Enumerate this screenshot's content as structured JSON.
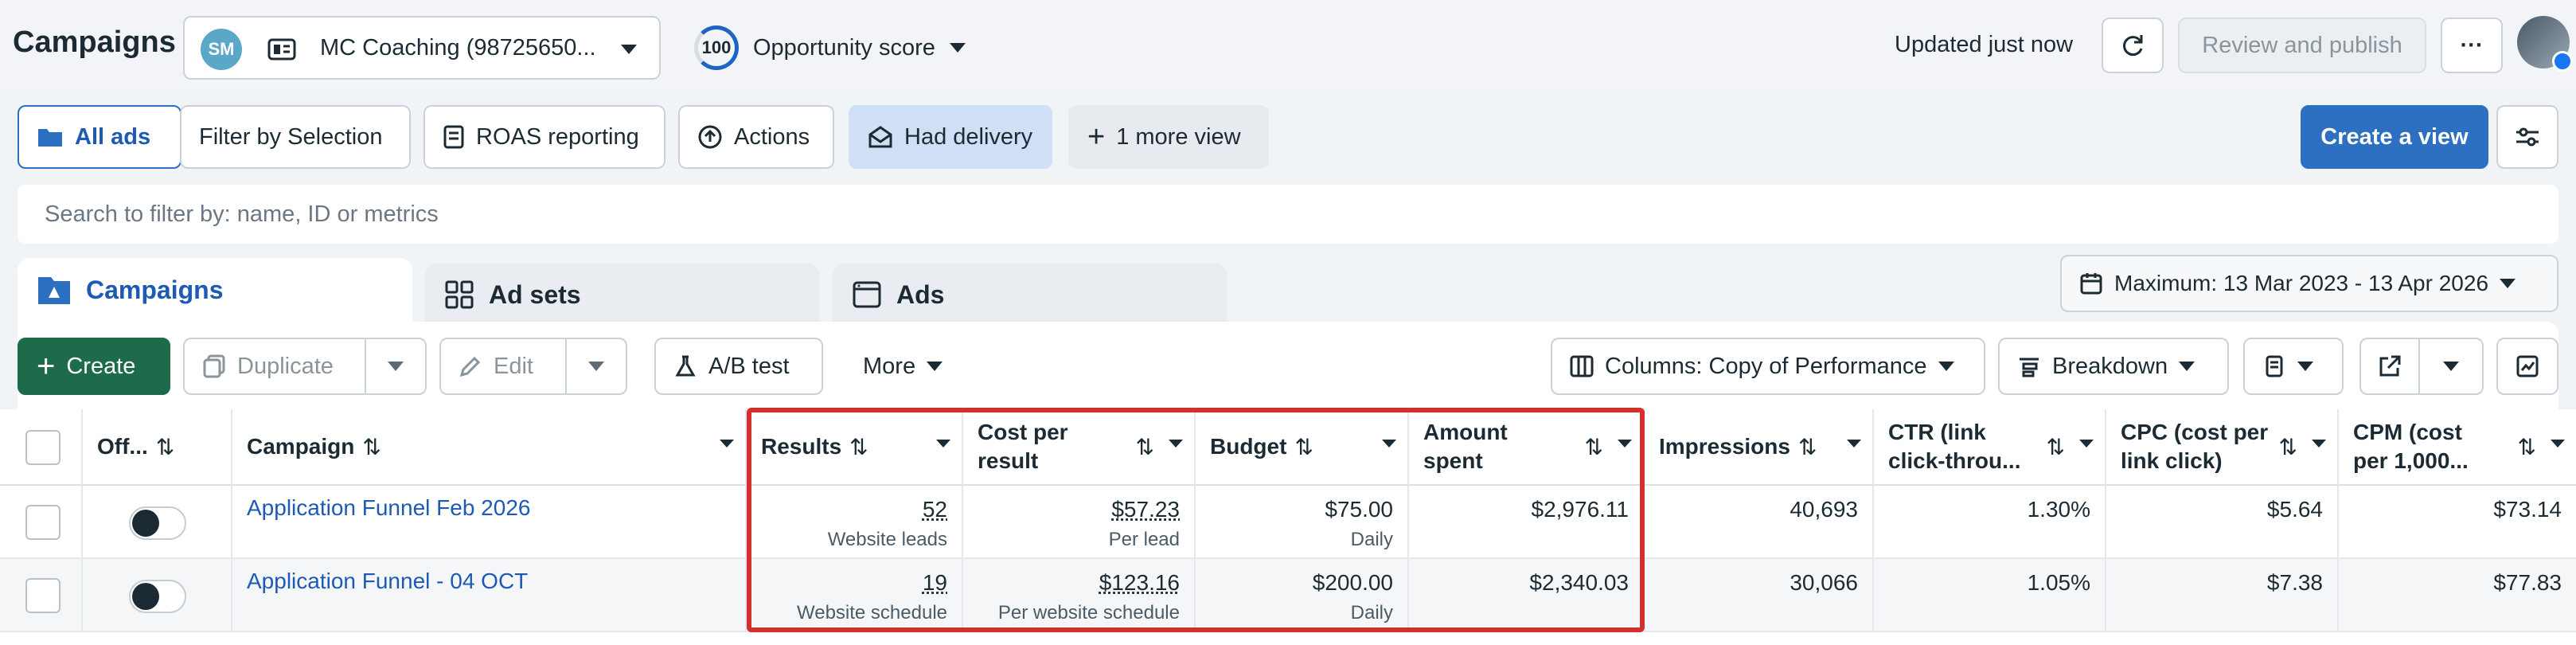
{
  "header": {
    "title": "Campaigns",
    "account_name": "MC Coaching (98725650...",
    "opportunity_value": "100",
    "opportunity_label": "Opportunity score",
    "updated": "Updated just now",
    "review_publish": "Review and publish",
    "more": "···"
  },
  "views": {
    "all_ads": "All ads",
    "filter_by_selection": "Filter by Selection",
    "roas_reporting": "ROAS reporting",
    "actions": "Actions",
    "had_delivery": "Had delivery",
    "more_view": "1 more view",
    "create_view": "Create a view"
  },
  "search": {
    "placeholder": "Search to filter by: name, ID or metrics"
  },
  "tabs": {
    "campaigns": "Campaigns",
    "ad_sets": "Ad sets",
    "ads": "Ads"
  },
  "date_range": "Maximum: 13 Mar 2023 - 13 Apr 2026",
  "toolbar": {
    "create": "Create",
    "duplicate": "Duplicate",
    "edit": "Edit",
    "ab_test": "A/B test",
    "more": "More",
    "columns": "Columns: Copy of Performance",
    "breakdown": "Breakdown"
  },
  "table": {
    "headers": {
      "off_on": "Off...",
      "campaign": "Campaign",
      "results": "Results",
      "cost_per_result_1": "Cost per",
      "cost_per_result_2": "result",
      "budget": "Budget",
      "amount_spent_1": "Amount",
      "amount_spent_2": "spent",
      "impressions": "Impressions",
      "ctr_1": "CTR (link",
      "ctr_2": "click-throu...",
      "cpc_1": "CPC (cost per",
      "cpc_2": "link click)",
      "cpm_1": "CPM (cost",
      "cpm_2": "per 1,000..."
    },
    "rows": [
      {
        "campaign": "Application Funnel Feb 2026",
        "results": "52",
        "results_type": "Website leads",
        "cost_per_result": "$57.23",
        "cost_type": "Per lead",
        "budget": "$75.00",
        "budget_type": "Daily",
        "amount_spent": "$2,976.11",
        "impressions": "40,693",
        "ctr": "1.30%",
        "cpc": "$5.64",
        "cpm": "$73.14"
      },
      {
        "campaign": "Application Funnel - 04 OCT",
        "results": "19",
        "results_type": "Website schedule",
        "cost_per_result": "$123.16",
        "cost_type": "Per website schedule",
        "budget": "$200.00",
        "budget_type": "Daily",
        "amount_spent": "$2,340.03",
        "impressions": "30,066",
        "ctr": "1.05%",
        "cpc": "$7.38",
        "cpm": "$77.83"
      }
    ]
  },
  "colors": {
    "primary": "#2d6fc0",
    "create_green": "#1e6b4b",
    "link": "#1d5ab4",
    "highlight": "#d32f2f"
  }
}
